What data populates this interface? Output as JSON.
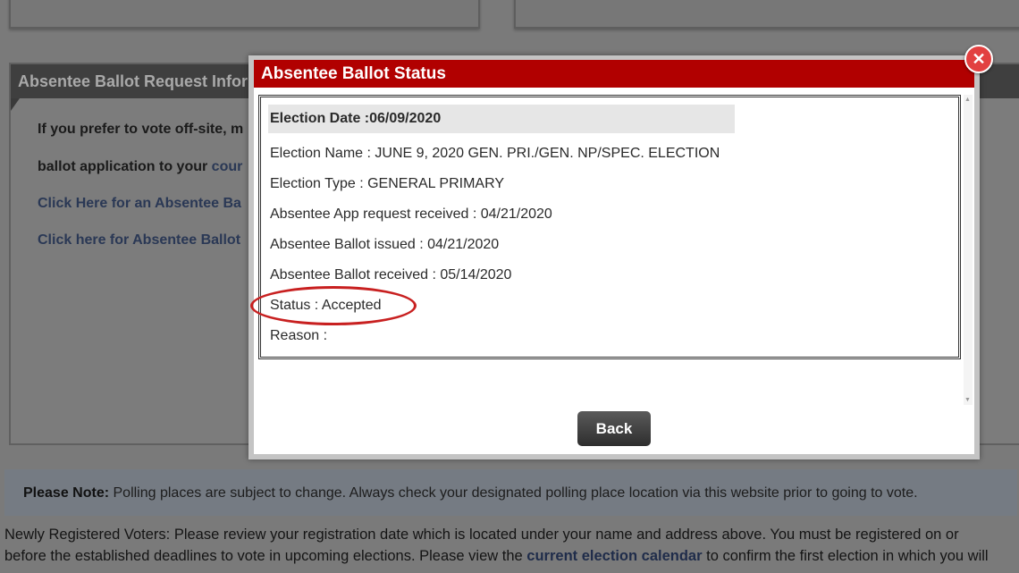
{
  "background": {
    "panel_title": "Absentee Ballot Request Infor",
    "lines": [
      {
        "text": "If you prefer to vote off-site, m",
        "link": ""
      },
      {
        "text": "ballot application to your ",
        "link": "cour"
      },
      {
        "text": "",
        "link": "Click Here for an Absentee Ba"
      },
      {
        "text": "",
        "link": "Click here for Absentee Ballot"
      }
    ],
    "note_label": "Please Note:",
    "note_text": " Polling places are subject to change. Always check your designated polling place location via this website prior to going to vote.",
    "para_line1": "Newly Registered Voters:  Please review your registration date which is located under your name and address above.  You must be registered on or",
    "para_line2_before": "before the established deadlines to vote in upcoming elections.  Please view the ",
    "para_line2_link": "current election calendar",
    "para_line2_after": " to confirm the first election in which you will"
  },
  "modal": {
    "title": "Absentee Ballot Status",
    "close_glyph": "✕",
    "rows": [
      "Election Date :06/09/2020",
      "Election Name : JUNE 9, 2020 GEN. PRI./GEN. NP/SPEC. ELECTION",
      "Election Type : GENERAL PRIMARY",
      "Absentee App request received : 04/21/2020",
      "Absentee Ballot issued : 04/21/2020",
      "Absentee Ballot received : 05/14/2020",
      "Status : Accepted",
      "Reason :"
    ],
    "back_label": "Back"
  },
  "colors": {
    "header_red": "#b10000",
    "highlight_ellipse": "#c82020",
    "link_blue": "#1f2c4a"
  },
  "icons": {
    "close": "close-icon",
    "scroll_up": "scroll-up-arrow-icon",
    "scroll_down": "scroll-down-arrow-icon"
  }
}
